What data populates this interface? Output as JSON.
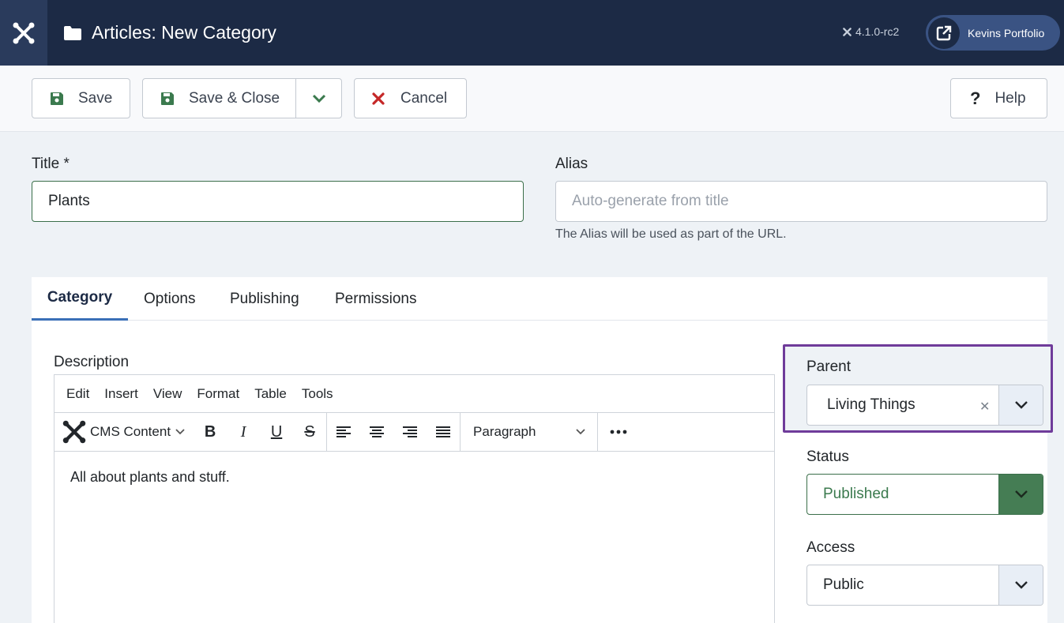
{
  "header": {
    "page_title": "Articles: New Category",
    "version": "4.1.0-rc2",
    "site_link_label": "Kevins Portfolio"
  },
  "toolbar": {
    "save_label": "Save",
    "save_close_label": "Save & Close",
    "cancel_label": "Cancel",
    "help_label": "Help"
  },
  "form": {
    "title_label": "Title *",
    "title_value": "Plants",
    "alias_label": "Alias",
    "alias_placeholder": "Auto-generate from title",
    "alias_help": "The Alias will be used as part of the URL."
  },
  "tabs": [
    {
      "label": "Category",
      "active": true
    },
    {
      "label": "Options",
      "active": false
    },
    {
      "label": "Publishing",
      "active": false
    },
    {
      "label": "Permissions",
      "active": false
    }
  ],
  "editor": {
    "description_label": "Description",
    "menu": [
      "Edit",
      "Insert",
      "View",
      "Format",
      "Table",
      "Tools"
    ],
    "cms_content_label": "CMS Content",
    "block_format": "Paragraph",
    "content": "All about plants and stuff."
  },
  "sidebar": {
    "parent_label": "Parent",
    "parent_value": "Living Things",
    "status_label": "Status",
    "status_value": "Published",
    "access_label": "Access",
    "access_value": "Public"
  },
  "colors": {
    "header_bg": "#1c2a45",
    "accent_blue": "#3a6fb7",
    "status_green": "#457d54",
    "highlight_purple": "#6f3b9a",
    "cancel_red": "#c52727"
  }
}
